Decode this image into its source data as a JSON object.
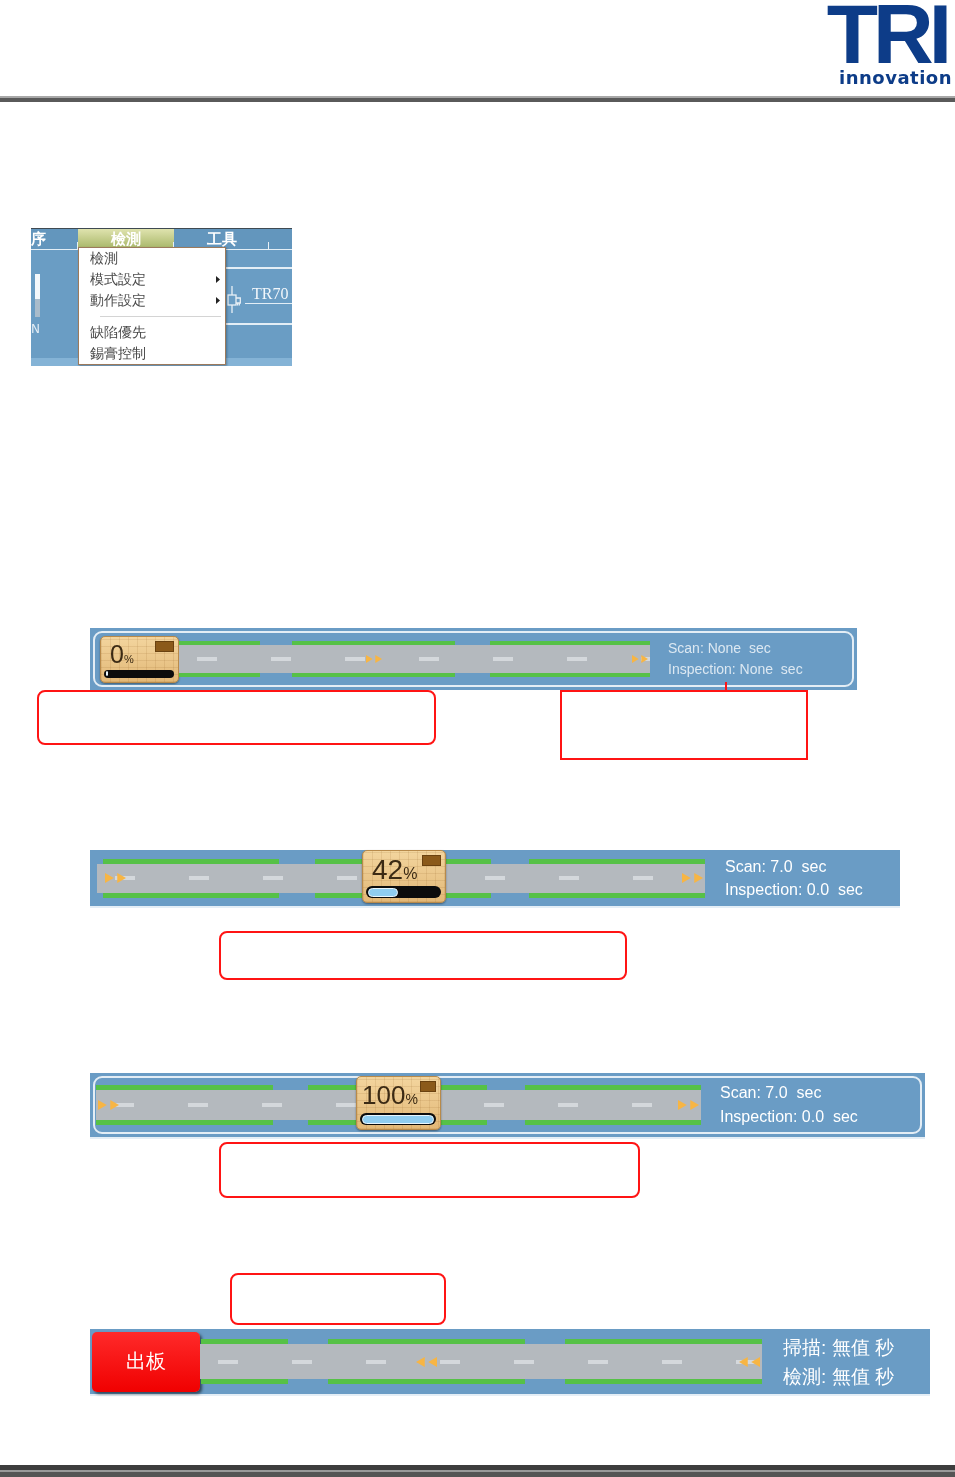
{
  "header": {
    "logo": {
      "mark": "TRI",
      "tagline": "innovation"
    }
  },
  "document": [
    {
      "kind": "menu_screenshot",
      "menubar": [
        {
          "label": "序",
          "selected": false
        },
        {
          "label": "檢測",
          "selected": true
        },
        {
          "label": "工具",
          "selected": false
        }
      ],
      "menu_groups": [
        {
          "items": [
            {
              "label": "檢測",
              "submenu": false
            },
            {
              "label": "模式設定",
              "submenu": true
            },
            {
              "label": "動作設定",
              "submenu": true
            }
          ]
        },
        {
          "items": [
            {
              "label": "缺陷優先",
              "submenu": false
            },
            {
              "label": "錫膏控制",
              "submenu": false
            }
          ]
        }
      ],
      "side_label": "N",
      "device_label": "TR70"
    },
    {
      "kind": "conveyor",
      "framed": true,
      "reverse": false,
      "board": {
        "value": "0",
        "unit": "%",
        "level": 0
      },
      "segments": [
        {
          "arrows": false
        },
        {
          "arrows": true
        },
        {
          "arrows": true
        }
      ],
      "scan": "Scan: None  sec",
      "inspection": "Inspection: None  sec"
    },
    {
      "kind": "callouts",
      "items": [
        {
          "rounded": true,
          "leader": false
        },
        {
          "rounded": false,
          "leader": true
        }
      ]
    },
    {
      "kind": "conveyor",
      "framed": false,
      "reverse": false,
      "board": {
        "value": "42",
        "unit": "%",
        "level": 0.42
      },
      "segments": [
        {
          "arrows": true
        },
        {
          "arrows": false
        },
        {
          "arrows": true
        }
      ],
      "scan": "Scan: 7.0  sec",
      "inspection": "Inspection: 0.0  sec"
    },
    {
      "kind": "callouts",
      "items": [
        {
          "rounded": true,
          "leader": false
        }
      ]
    },
    {
      "kind": "conveyor",
      "framed": true,
      "reverse": false,
      "board": {
        "value": "100",
        "unit": "%",
        "level": 1
      },
      "segments": [
        {
          "arrows": true
        },
        {
          "arrows": false
        },
        {
          "arrows": true
        }
      ],
      "scan": "Scan: 7.0  sec",
      "inspection": "Inspection: 0.0  sec"
    },
    {
      "kind": "callouts",
      "items": [
        {
          "rounded": true,
          "leader": false
        }
      ]
    },
    {
      "kind": "callouts",
      "items": [
        {
          "rounded": true,
          "leader": false
        }
      ]
    },
    {
      "kind": "conveyor",
      "framed": false,
      "reverse": true,
      "unload_button": {
        "label": "出板"
      },
      "segments": [
        {
          "arrows": false
        },
        {
          "arrows": true
        },
        {
          "arrows": true
        }
      ],
      "scan": "掃描: 無值 秒",
      "inspection": "檢測: 無值 秒"
    }
  ]
}
